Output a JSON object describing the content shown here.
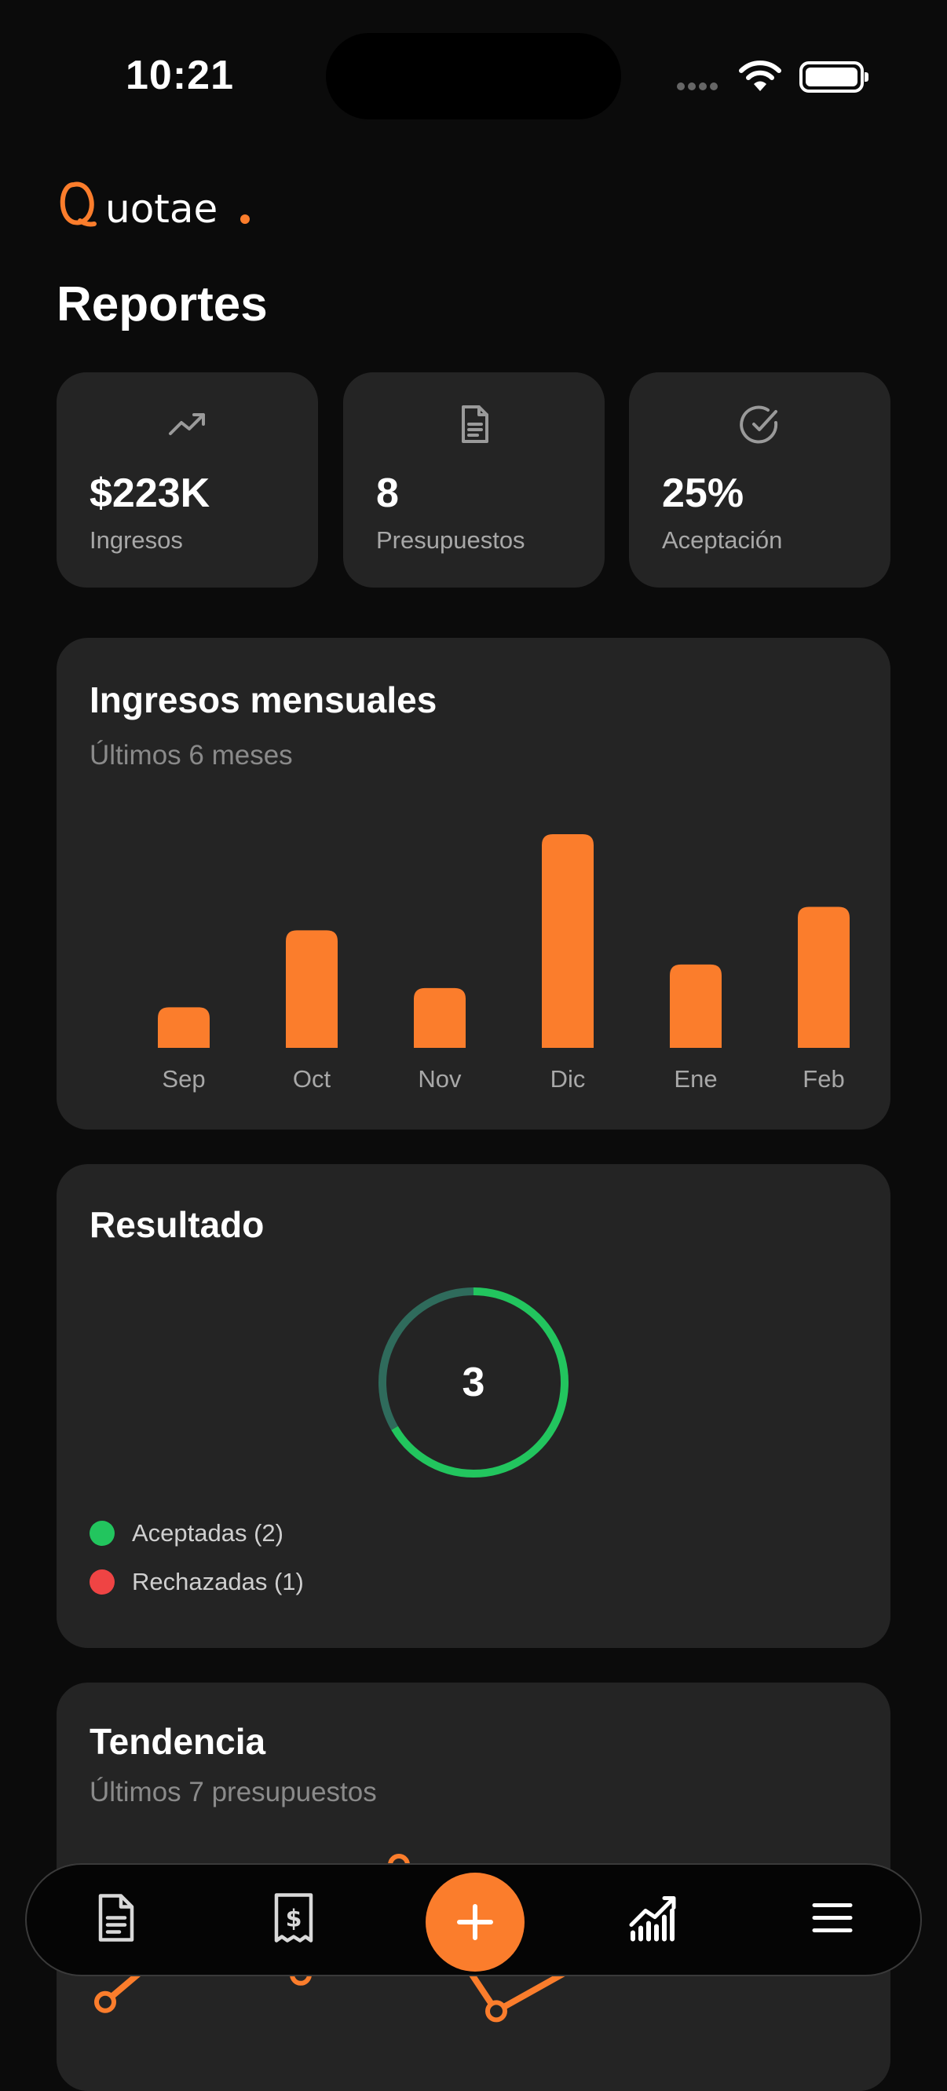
{
  "status_bar": {
    "time": "10:21"
  },
  "app": {
    "logo_text": "Quotae."
  },
  "page": {
    "title": "Reportes"
  },
  "stats": [
    {
      "icon": "trending-up-icon",
      "value": "$223K",
      "label": "Ingresos"
    },
    {
      "icon": "document-icon",
      "value": "8",
      "label": "Presupuestos"
    },
    {
      "icon": "check-circle-icon",
      "value": "25%",
      "label": "Aceptación"
    }
  ],
  "monthly": {
    "title": "Ingresos mensuales",
    "subtitle": "Últimos 6 meses"
  },
  "result": {
    "title": "Resultado",
    "total": "3",
    "accepted_label": "Aceptadas (2)",
    "rejected_label": "Rechazadas (1)"
  },
  "trend": {
    "title": "Tendencia",
    "subtitle": "Últimos 7 presupuestos"
  },
  "colors": {
    "accent": "#fb7d2c",
    "accepted": "#22c55e",
    "rejected": "#ef4444",
    "card": "#242424",
    "background": "#0b0b0b"
  },
  "nav": {
    "items": [
      "document-icon",
      "receipt-icon",
      "add-icon",
      "chart-icon",
      "menu-icon"
    ]
  },
  "chart_data": [
    {
      "type": "bar",
      "title": "Ingresos mensuales",
      "subtitle": "Últimos 6 meses",
      "categories": [
        "Sep",
        "Oct",
        "Nov",
        "Dic",
        "Ene",
        "Feb"
      ],
      "values": [
        19,
        55,
        28,
        100,
        39,
        66
      ],
      "ylim": [
        0,
        100
      ],
      "grid": false
    },
    {
      "type": "pie",
      "title": "Resultado",
      "center_label": "3",
      "categories": [
        "Aceptadas (2)",
        "Rechazadas (1)"
      ],
      "values": [
        2,
        1
      ]
    },
    {
      "type": "line",
      "title": "Tendencia",
      "subtitle": "Últimos 7 presupuestos",
      "x": [
        1,
        2,
        3,
        4,
        5,
        6,
        7
      ],
      "values": [
        25,
        70,
        40,
        100,
        20,
        50,
        82
      ],
      "ylim": [
        0,
        100
      ],
      "note_visible_points": "partially hidden behind bottom navigation"
    }
  ]
}
